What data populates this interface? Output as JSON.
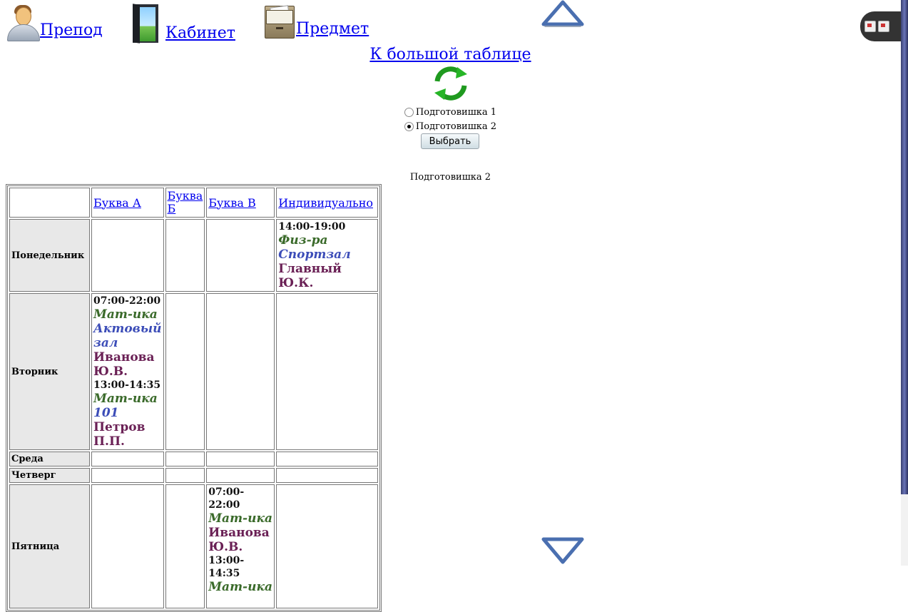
{
  "nav": {
    "teacher": "Препод",
    "room": "Кабинет",
    "subject": "Предмет"
  },
  "big_table_link": "К большой таблице",
  "groups": {
    "options": [
      "Подготовишка 1",
      "Подготовишка 2"
    ],
    "selected": "Подготовишка 2",
    "submit_label": "Выбрать"
  },
  "caption": "Подготовишка 2",
  "table": {
    "columns": [
      "Буква А",
      "Буква Б",
      "Буква В",
      "Индивидуально"
    ],
    "days": [
      "Понедельник",
      "Вторник",
      "Среда",
      "Четверг",
      "Пятница"
    ],
    "lessons": {
      "mon_individual": {
        "time": "14:00-19:00",
        "subject": "Физ-ра",
        "room": "Спортзал",
        "teacher": "Главный Ю.К."
      },
      "tue_a_1": {
        "time": "07:00-22:00",
        "subject": "Мат-ика",
        "room": "Актовый зал",
        "teacher": "Иванова Ю.В."
      },
      "tue_a_2": {
        "time": "13:00-14:35",
        "subject": "Мат-ика",
        "room": "101",
        "teacher": "Петров П.П."
      },
      "fri_v_1": {
        "time": "07:00-22:00",
        "subject": "Мат-ика",
        "teacher": "Иванова Ю.В."
      },
      "fri_v_2": {
        "time": "13:00-14:35",
        "subject": "Мат-ика"
      }
    }
  },
  "colors": {
    "link": "#0000ee",
    "subject": "#3a6a2a",
    "room": "#3c4db8",
    "teacher": "#6a2055",
    "day_bg": "#e8e8e8"
  }
}
